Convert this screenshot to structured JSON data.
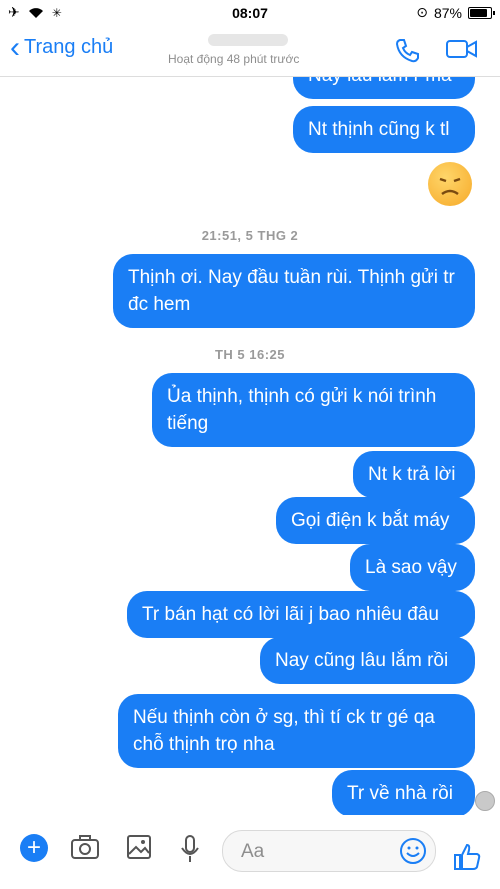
{
  "status": {
    "time": "08:07",
    "battery": "87%",
    "battery_level": 0.87
  },
  "header": {
    "back_label": "Trang chủ",
    "activity": "Hoạt động 48 phút trước"
  },
  "messages": [
    "Nay lâu lắm r mà",
    "Nt thịnh cũng k tl",
    "Thịnh ơi. Nay đầu tuần rùi. Thịnh gửi tr đc hem",
    "Ủa thịnh, thịnh có gửi k nói trình tiếng",
    "Nt k trả lời",
    "Gọi điện k bắt máy",
    "Là sao vậy",
    "Tr bán hạt có lời lãi j bao nhiêu đâu",
    "Nay cũng lâu lắm rồi",
    "Nếu thịnh còn ở sg, thì tí ck tr gé qa chỗ thịnh trọ nha",
    "Tr về nhà rồi"
  ],
  "timestamps": [
    "21:51, 5 THG 2",
    "TH 5 16:25"
  ],
  "composer": {
    "placeholder": "Aa"
  }
}
